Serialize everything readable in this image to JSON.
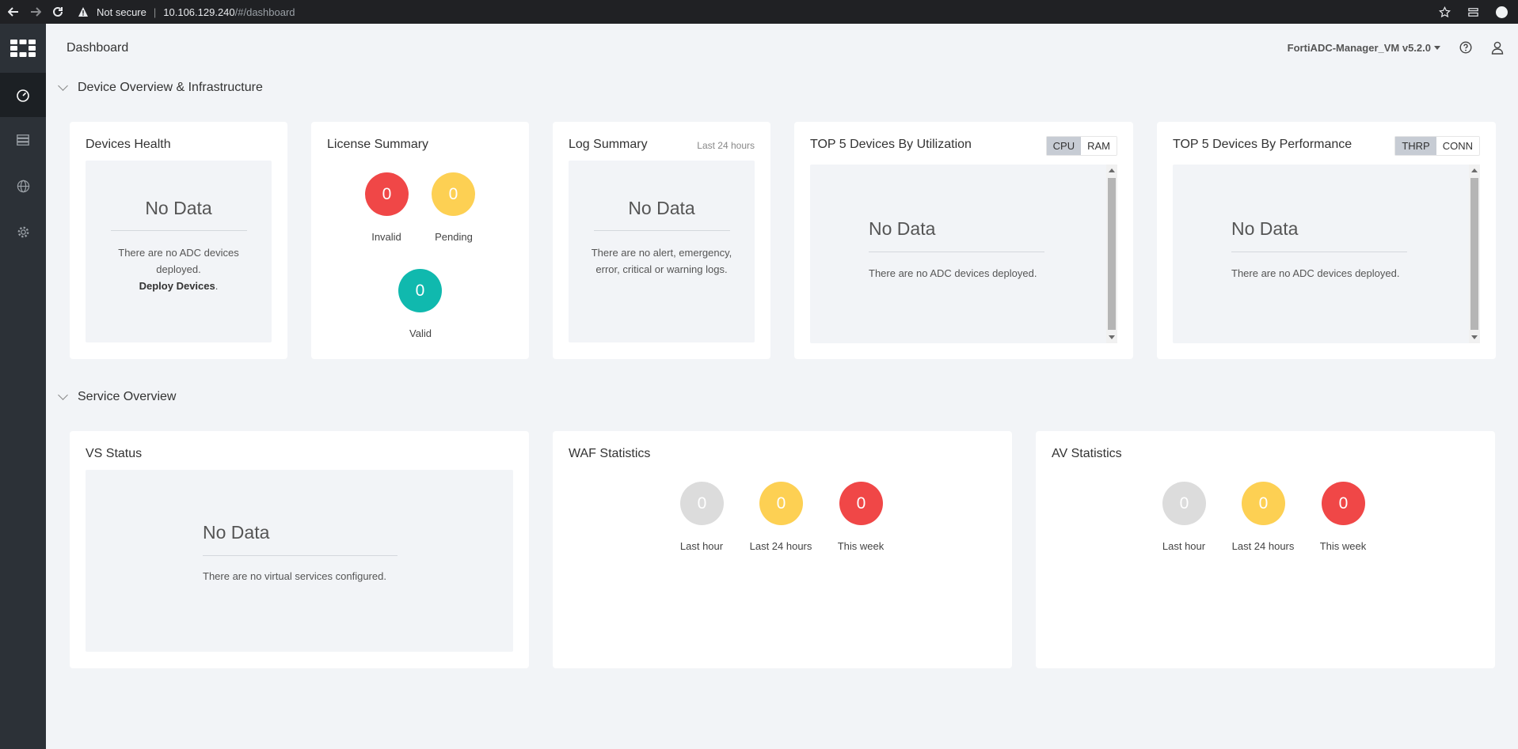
{
  "browser": {
    "security_label": "Not secure",
    "url_host": "10.106.129.240",
    "url_path": "/#/dashboard"
  },
  "header": {
    "title": "Dashboard",
    "device": "FortiADC-Manager_VM v5.2.0"
  },
  "sections": {
    "device_overview": "Device Overview & Infrastructure",
    "service_overview": "Service Overview"
  },
  "devices_health": {
    "title": "Devices Health",
    "nodata": "No Data",
    "message": "There are no ADC devices deployed.",
    "link": "Deploy Devices",
    "suffix": "."
  },
  "license_summary": {
    "title": "License Summary",
    "invalid_value": "0",
    "invalid_label": "Invalid",
    "pending_value": "0",
    "pending_label": "Pending",
    "valid_value": "0",
    "valid_label": "Valid"
  },
  "log_summary": {
    "title": "Log Summary",
    "subtitle": "Last 24 hours",
    "nodata": "No Data",
    "message": "There are no alert, emergency, error, critical or warning logs."
  },
  "top_utilization": {
    "title": "TOP 5 Devices By Utilization",
    "options": [
      "CPU",
      "RAM"
    ],
    "selected": "CPU",
    "nodata": "No Data",
    "message": "There are no ADC devices deployed."
  },
  "top_performance": {
    "title": "TOP 5 Devices By Performance",
    "options": [
      "THRP",
      "CONN"
    ],
    "selected": "THRP",
    "nodata": "No Data",
    "message": "There are no ADC devices deployed."
  },
  "vs_status": {
    "title": "VS Status",
    "nodata": "No Data",
    "message": "There are no virtual services configured."
  },
  "waf_statistics": {
    "title": "WAF Statistics",
    "last_hour_value": "0",
    "last_hour_label": "Last hour",
    "last_24_value": "0",
    "last_24_label": "Last 24 hours",
    "this_week_value": "0",
    "this_week_label": "This week"
  },
  "av_statistics": {
    "title": "AV Statistics",
    "last_hour_value": "0",
    "last_hour_label": "Last hour",
    "last_24_value": "0",
    "last_24_label": "Last 24 hours",
    "this_week_value": "0",
    "this_week_label": "This week"
  },
  "colors": {
    "red": "#f04747",
    "yellow": "#fdd053",
    "teal": "#10b9ae",
    "grey": "#dcdcdc"
  },
  "nav": {
    "items": [
      "dashboard-icon",
      "devices-icon",
      "globe-icon",
      "settings-icon"
    ]
  }
}
